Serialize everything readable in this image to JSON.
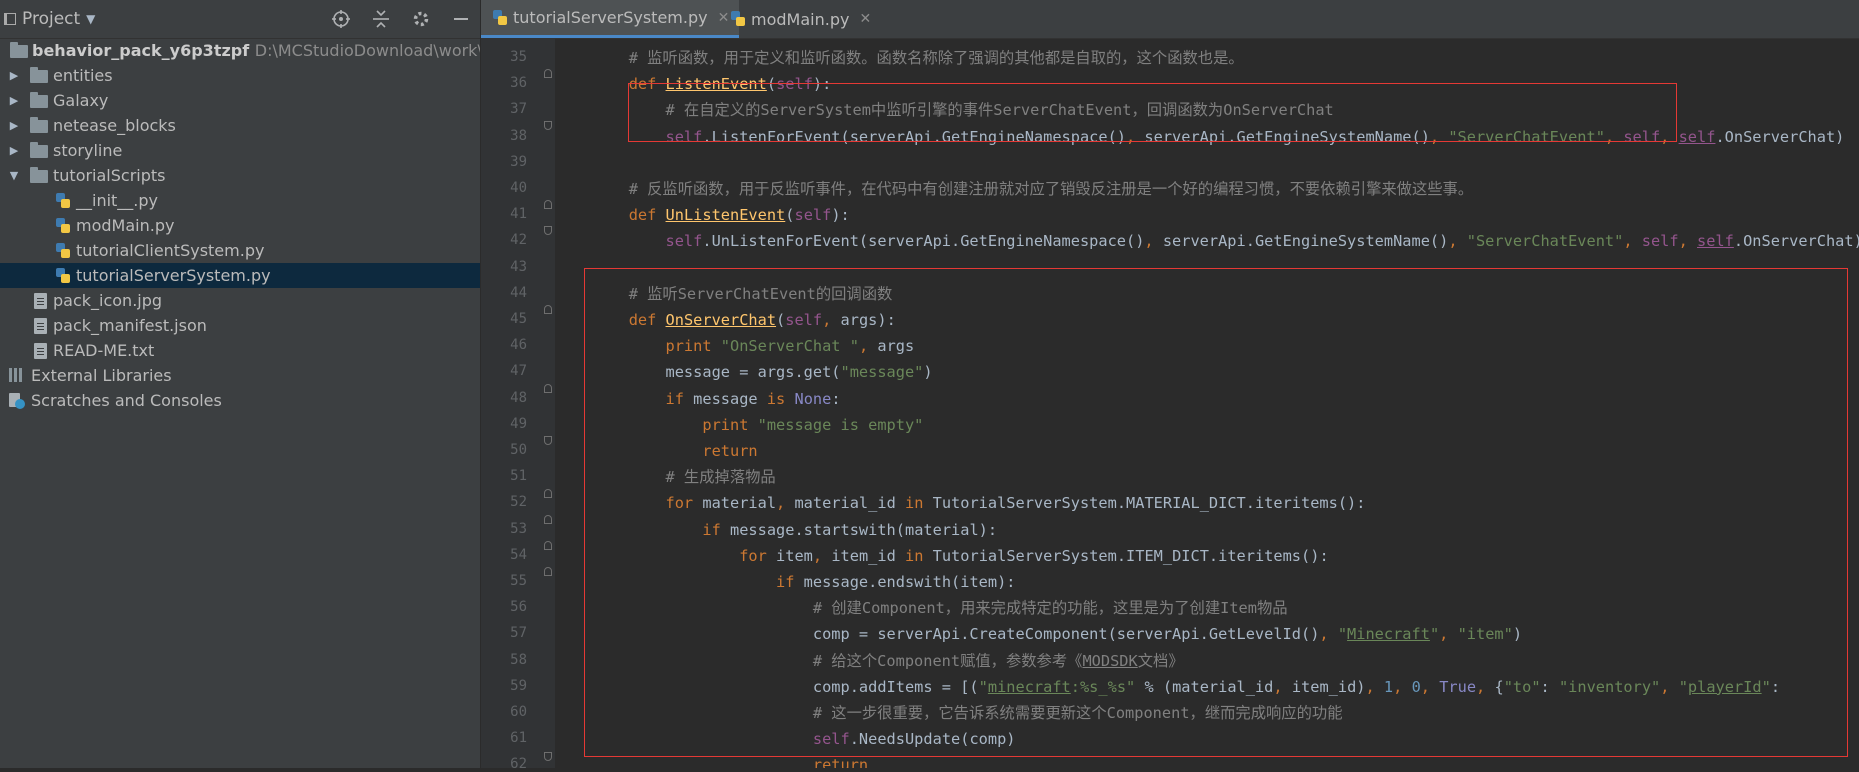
{
  "sidebar": {
    "title": "Project",
    "tree": [
      {
        "label": "behavior_pack_y6p3tzpf",
        "path": "D:\\MCStudioDownload\\work\\chenz",
        "icon": "folder-icon",
        "expanded": true,
        "level": 0
      },
      {
        "label": "entities",
        "icon": "folder-icon",
        "level": 1
      },
      {
        "label": "Galaxy",
        "icon": "folder-icon",
        "level": 1
      },
      {
        "label": "netease_blocks",
        "icon": "folder-icon",
        "level": 1
      },
      {
        "label": "storyline",
        "icon": "folder-icon",
        "level": 1
      },
      {
        "label": "tutorialScripts",
        "icon": "folder-icon",
        "expanded": true,
        "level": 1
      },
      {
        "label": "__init__.py",
        "icon": "python-file-icon",
        "level": 2
      },
      {
        "label": "modMain.py",
        "icon": "python-file-icon",
        "level": 2
      },
      {
        "label": "tutorialClientSystem.py",
        "icon": "python-file-icon",
        "level": 2
      },
      {
        "label": "tutorialServerSystem.py",
        "icon": "python-file-icon",
        "level": 2,
        "selected": true
      },
      {
        "label": "pack_icon.jpg",
        "icon": "image-file-icon",
        "level": 1
      },
      {
        "label": "pack_manifest.json",
        "icon": "json-file-icon",
        "level": 1
      },
      {
        "label": "READ-ME.txt",
        "icon": "text-file-icon",
        "level": 1
      },
      {
        "label": "External Libraries",
        "icon": "libraries-icon",
        "level": 0
      },
      {
        "label": "Scratches and Consoles",
        "icon": "scratches-icon",
        "level": 0
      }
    ]
  },
  "tabs": [
    {
      "label": "tutorialServerSystem.py",
      "active": true
    },
    {
      "label": "modMain.py",
      "active": false
    }
  ],
  "editor": {
    "lines": [
      {
        "n": "35",
        "tokens": [
          [
            "        ",
            ""
          ],
          [
            "# 监听函数，用于定义和监听函数。函数名称除了强调的其他都是自取的，这个函数也是。",
            "cm"
          ]
        ]
      },
      {
        "n": "36",
        "tokens": [
          [
            "        ",
            ""
          ],
          [
            "def ",
            "kw"
          ],
          [
            "ListenEvent",
            "fn"
          ],
          [
            "(",
            ""
          ],
          [
            "self",
            "sf"
          ],
          [
            "):",
            ""
          ]
        ]
      },
      {
        "n": "37",
        "tokens": [
          [
            "            ",
            ""
          ],
          [
            "# 在自定义的ServerSystem中监听引擎的事件ServerChatEvent，回调函数为OnServerChat",
            "cm"
          ]
        ]
      },
      {
        "n": "38",
        "tokens": [
          [
            "            ",
            ""
          ],
          [
            "self",
            "sf"
          ],
          [
            ".ListenForEvent(serverApi.GetEngineNamespace()",
            ""
          ],
          [
            ", ",
            "kw"
          ],
          [
            "serverApi.GetEngineSystemName()",
            ""
          ],
          [
            ", ",
            "kw"
          ],
          [
            "\"ServerChatEvent\"",
            "str"
          ],
          [
            ", ",
            "kw"
          ],
          [
            "self",
            "sf"
          ],
          [
            ", ",
            "kw"
          ],
          [
            "self",
            "sf ul"
          ],
          [
            ".OnServerChat)",
            ""
          ]
        ]
      },
      {
        "n": "39",
        "tokens": []
      },
      {
        "n": "40",
        "tokens": [
          [
            "        ",
            ""
          ],
          [
            "# 反监听函数，用于反监听事件，在代码中有创建注册就对应了销毁反注册是一个好的编程习惯，不要依赖引擎来做这些事。",
            "cm"
          ]
        ]
      },
      {
        "n": "41",
        "tokens": [
          [
            "        ",
            ""
          ],
          [
            "def ",
            "kw"
          ],
          [
            "UnListenEvent",
            "fn"
          ],
          [
            "(",
            ""
          ],
          [
            "self",
            "sf"
          ],
          [
            "):",
            ""
          ]
        ]
      },
      {
        "n": "42",
        "tokens": [
          [
            "            ",
            ""
          ],
          [
            "self",
            "sf"
          ],
          [
            ".UnListenForEvent(serverApi.GetEngineNamespace()",
            ""
          ],
          [
            ", ",
            "kw"
          ],
          [
            "serverApi.GetEngineSystemName()",
            ""
          ],
          [
            ", ",
            "kw"
          ],
          [
            "\"ServerChatEvent\"",
            "str"
          ],
          [
            ", ",
            "kw"
          ],
          [
            "self",
            "sf"
          ],
          [
            ", ",
            "kw"
          ],
          [
            "self",
            "sf ul"
          ],
          [
            ".OnServerChat)",
            ""
          ]
        ]
      },
      {
        "n": "43",
        "tokens": []
      },
      {
        "n": "44",
        "tokens": [
          [
            "        ",
            ""
          ],
          [
            "# 监听ServerChatEvent的回调函数",
            "cm"
          ]
        ]
      },
      {
        "n": "45",
        "tokens": [
          [
            "        ",
            ""
          ],
          [
            "def ",
            "kw"
          ],
          [
            "OnServerChat",
            "fn"
          ],
          [
            "(",
            ""
          ],
          [
            "self",
            "sf"
          ],
          [
            ", ",
            "kw"
          ],
          [
            "args):",
            ""
          ]
        ]
      },
      {
        "n": "46",
        "tokens": [
          [
            "            ",
            ""
          ],
          [
            "print ",
            "kw"
          ],
          [
            "\"OnServerChat \"",
            "str"
          ],
          [
            ", ",
            "kw"
          ],
          [
            "args",
            ""
          ]
        ]
      },
      {
        "n": "47",
        "tokens": [
          [
            "            ",
            ""
          ],
          [
            "message = args.get(",
            ""
          ],
          [
            "\"message\"",
            "str"
          ],
          [
            ")",
            ""
          ]
        ]
      },
      {
        "n": "48",
        "tokens": [
          [
            "            ",
            ""
          ],
          [
            "if ",
            "kw"
          ],
          [
            "message ",
            ""
          ],
          [
            "is ",
            "kw"
          ],
          [
            "None",
            "bi"
          ],
          [
            ":",
            ""
          ]
        ]
      },
      {
        "n": "49",
        "tokens": [
          [
            "                ",
            ""
          ],
          [
            "print ",
            "kw"
          ],
          [
            "\"message is empty\"",
            "str"
          ]
        ]
      },
      {
        "n": "50",
        "tokens": [
          [
            "                ",
            ""
          ],
          [
            "return",
            "kw"
          ]
        ]
      },
      {
        "n": "51",
        "tokens": [
          [
            "            ",
            ""
          ],
          [
            "# 生成掉落物品",
            "cm"
          ]
        ]
      },
      {
        "n": "52",
        "tokens": [
          [
            "            ",
            ""
          ],
          [
            "for ",
            "kw"
          ],
          [
            "material",
            ""
          ],
          [
            ", ",
            "kw"
          ],
          [
            "material_id ",
            ""
          ],
          [
            "in ",
            "kw"
          ],
          [
            "TutorialServerSystem.MATERIAL_DICT.iteritems():",
            ""
          ]
        ]
      },
      {
        "n": "53",
        "tokens": [
          [
            "                ",
            ""
          ],
          [
            "if ",
            "kw"
          ],
          [
            "message.startswith(material):",
            ""
          ]
        ]
      },
      {
        "n": "54",
        "tokens": [
          [
            "                    ",
            ""
          ],
          [
            "for ",
            "kw"
          ],
          [
            "item",
            ""
          ],
          [
            ", ",
            "kw"
          ],
          [
            "item_id ",
            ""
          ],
          [
            "in ",
            "kw"
          ],
          [
            "TutorialServerSystem.ITEM_DICT.iteritems():",
            ""
          ]
        ]
      },
      {
        "n": "55",
        "tokens": [
          [
            "                        ",
            ""
          ],
          [
            "if ",
            "kw"
          ],
          [
            "message.endswith(item):",
            ""
          ]
        ]
      },
      {
        "n": "56",
        "tokens": [
          [
            "                            ",
            ""
          ],
          [
            "# 创建Component，用来完成特定的功能，这里是为了创建Item物品",
            "cm"
          ]
        ]
      },
      {
        "n": "57",
        "tokens": [
          [
            "                            ",
            ""
          ],
          [
            "comp = serverApi.CreateComponent(serverApi.GetLevelId()",
            ""
          ],
          [
            ", ",
            "kw"
          ],
          [
            "\"",
            "str"
          ],
          [
            "Minecraft",
            "str ul"
          ],
          [
            "\"",
            "str"
          ],
          [
            ", ",
            "kw"
          ],
          [
            "\"item\"",
            "str"
          ],
          [
            ")",
            ""
          ]
        ]
      },
      {
        "n": "58",
        "tokens": [
          [
            "                            ",
            ""
          ],
          [
            "# 给这个Component赋值，参数参考《",
            "cm"
          ],
          [
            "MODSDK",
            "cm ul"
          ],
          [
            "文档》",
            "cm"
          ]
        ]
      },
      {
        "n": "59",
        "tokens": [
          [
            "                            ",
            ""
          ],
          [
            "comp.addItems = [(",
            ""
          ],
          [
            "\"",
            "str"
          ],
          [
            "minecraft",
            "str ul"
          ],
          [
            ":%s_%s\"",
            "str"
          ],
          [
            " % (material_id",
            ""
          ],
          [
            ", ",
            "kw"
          ],
          [
            "item_id)",
            ""
          ],
          [
            ", ",
            "kw"
          ],
          [
            "1",
            "num"
          ],
          [
            ", ",
            "kw"
          ],
          [
            "0",
            "num"
          ],
          [
            ", ",
            "kw"
          ],
          [
            "True",
            "bi"
          ],
          [
            ", ",
            "kw"
          ],
          [
            "{",
            ""
          ],
          [
            "\"to\"",
            "str"
          ],
          [
            ": ",
            ""
          ],
          [
            "\"inventory\"",
            "str"
          ],
          [
            ", ",
            "kw"
          ],
          [
            "\"",
            "str"
          ],
          [
            "playerId",
            "str ul"
          ],
          [
            "\"",
            "str"
          ],
          [
            ":",
            ""
          ]
        ]
      },
      {
        "n": "60",
        "tokens": [
          [
            "                            ",
            ""
          ],
          [
            "# 这一步很重要，它告诉系统需要更新这个Component，继而完成响应的功能",
            "cm"
          ]
        ]
      },
      {
        "n": "61",
        "tokens": [
          [
            "                            ",
            ""
          ],
          [
            "self",
            "sf"
          ],
          [
            ".NeedsUpdate(comp)",
            ""
          ]
        ]
      },
      {
        "n": "62",
        "tokens": [
          [
            "                            ",
            ""
          ],
          [
            "return",
            "kw"
          ]
        ]
      }
    ]
  },
  "colors": {
    "highlight_box": "#e53935",
    "selection": "#0d293e",
    "tab_accent": "#4a88c7"
  }
}
